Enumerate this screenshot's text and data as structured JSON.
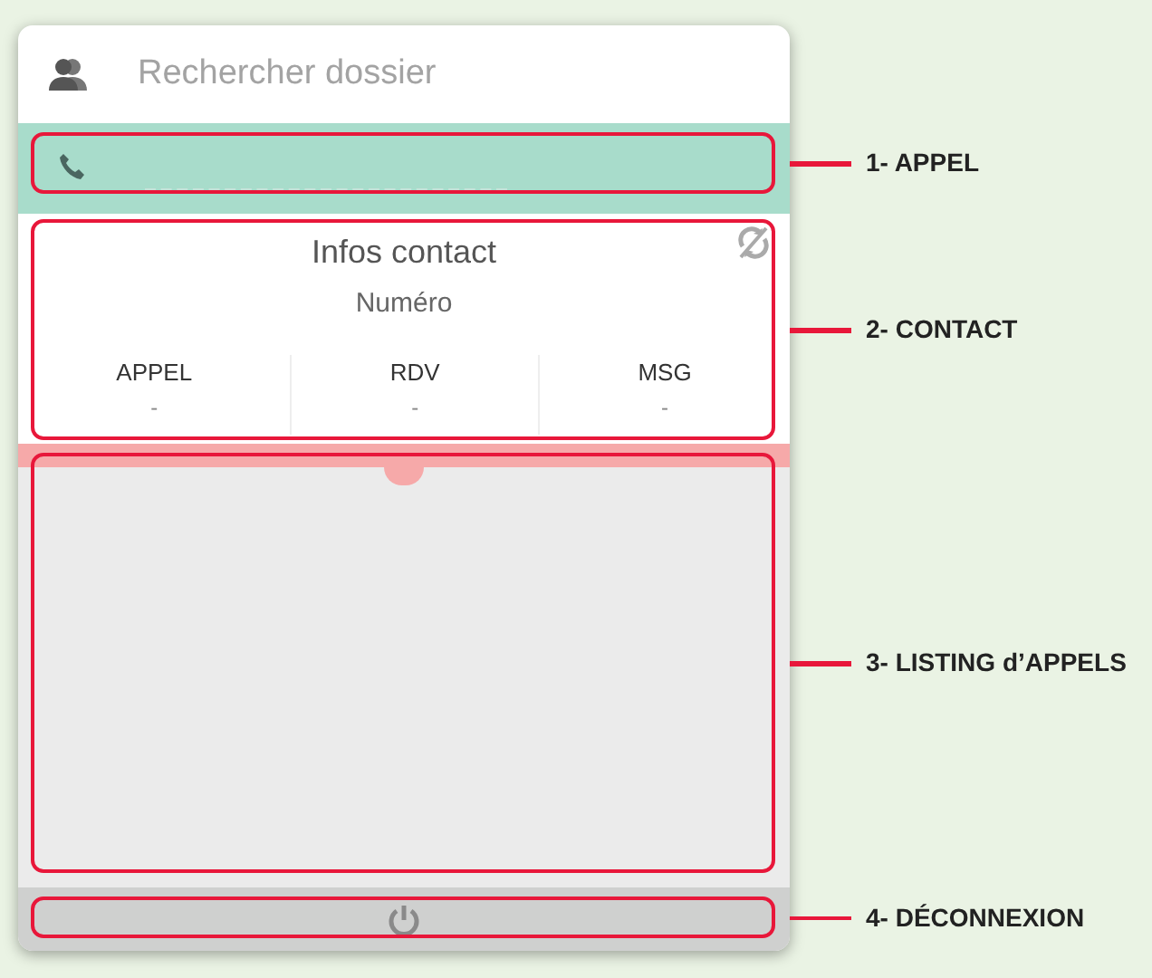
{
  "search": {
    "placeholder": "Rechercher dossier"
  },
  "contact": {
    "title": "Infos contact",
    "subtitle": "Numéro",
    "stats": [
      {
        "label": "APPEL",
        "value": "-"
      },
      {
        "label": "RDV",
        "value": "-"
      },
      {
        "label": "MSG",
        "value": "-"
      }
    ]
  },
  "annotations": [
    {
      "label": "1- APPEL"
    },
    {
      "label": "2- CONTACT"
    },
    {
      "label": "3- LISTING d’APPELS"
    },
    {
      "label": "4- DÉCONNEXION"
    }
  ]
}
